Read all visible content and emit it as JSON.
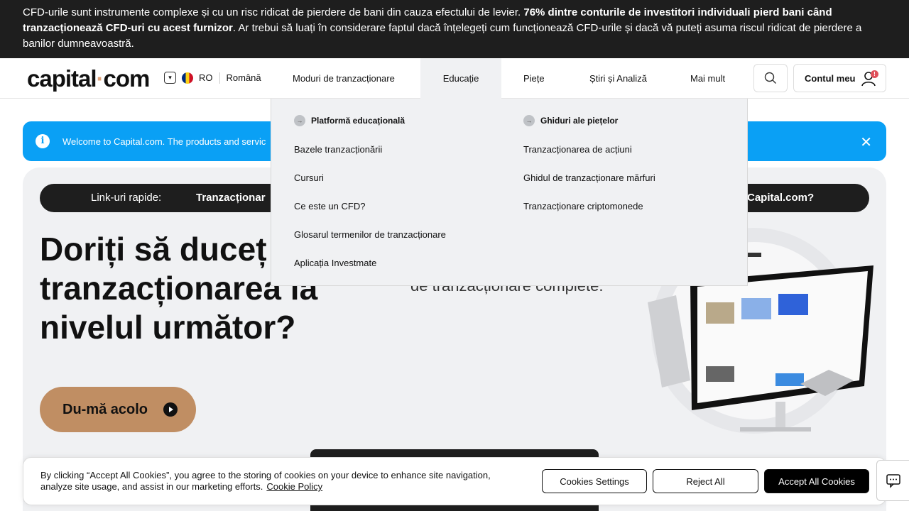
{
  "risk_warning": {
    "part1": "CFD-urile sunt instrumente complexe și cu un risc ridicat de pierdere de bani din cauza efectului de levier. ",
    "bold": "76% dintre conturile de investitori individuali pierd bani când tranzacționează CFD-uri cu acest furnizor",
    "part2": ". Ar trebui să luați în considerare faptul dacă înțelegeți cum funcționează CFD-urile și dacă vă puteți asuma riscul ridicat de pierdere a banilor dumneavoastră."
  },
  "header": {
    "logo_left": "capital",
    "logo_dot": "·",
    "logo_right": "com",
    "country_code": "RO",
    "language": "Română",
    "nav": [
      {
        "label": "Moduri de tranzacționare"
      },
      {
        "label": "Educație"
      },
      {
        "label": "Piețe"
      },
      {
        "label": "Știri și Analiză"
      },
      {
        "label": "Mai mult"
      }
    ],
    "account_label": "Contul meu",
    "account_badge": "!"
  },
  "welcome": {
    "text": "Welcome to Capital.com. The products and servic"
  },
  "quick_links": {
    "label": "Link-uri rapide:",
    "first": "Tranzacționar",
    "last": "Capital.com?"
  },
  "hero": {
    "title": "Doriți să duceț tranzacționarea la nivelul următor?",
    "subtitle": "de tranzacționare complete.",
    "cta": "Du-mă acolo"
  },
  "dropdown": {
    "col1": {
      "heading": "Platformă educațională",
      "links": [
        "Bazele tranzacționării",
        "Cursuri",
        "Ce este un CFD?",
        "Glosarul termenilor de tranzacționare",
        "Aplicația Investmate"
      ]
    },
    "col2": {
      "heading": "Ghiduri ale piețelor",
      "links": [
        "Tranzacționarea de acțiuni",
        "Ghidul de tranzacționare mărfuri",
        "Tranzacționare criptomonede"
      ]
    }
  },
  "cookie": {
    "text": "By clicking “Accept All Cookies”, you agree to the storing of cookies on your device to enhance site navigation, analyze site usage, and assist in our marketing efforts.",
    "policy_link": "Cookie Policy",
    "settings": "Cookies Settings",
    "reject": "Reject All",
    "accept": "Accept All Cookies"
  }
}
